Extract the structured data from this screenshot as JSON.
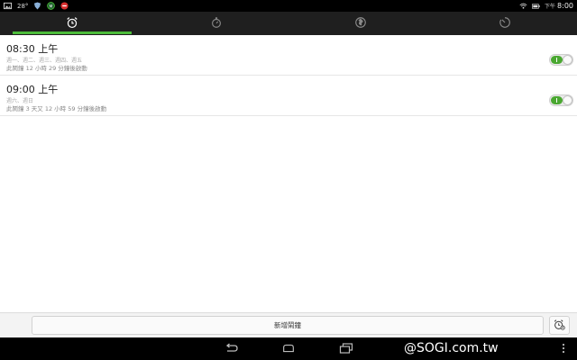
{
  "status_bar": {
    "temperature": "28°",
    "left_icons": [
      "image-icon",
      "shield-icon",
      "badge-icon",
      "app-icon"
    ],
    "right_icons": [
      "wifi-icon",
      "battery-icon"
    ],
    "ampm": "下午",
    "time": "8:00"
  },
  "tabs": [
    {
      "icon": "alarm-clock-icon",
      "active": true
    },
    {
      "icon": "stopwatch-icon",
      "active": false
    },
    {
      "icon": "world-clock-icon",
      "active": false
    },
    {
      "icon": "timer-icon",
      "active": false
    }
  ],
  "alarms": [
    {
      "time": "08:30 上午",
      "days": "週一、週二、週三、週四、週五",
      "remaining": "此鬧鐘 12 小時 29 分鐘後啟動",
      "enabled": true
    },
    {
      "time": "09:00 上午",
      "days": "週六、週日",
      "remaining": "此鬧鐘 3 天又 12 小時 59 分鐘後啟動",
      "enabled": true
    }
  ],
  "action_bar": {
    "add_alarm_label": "新增鬧鐘",
    "settings_icon": "alarm-settings-icon"
  },
  "nav_bar": {
    "icons": [
      "back-icon",
      "home-icon",
      "recent-apps-icon",
      "menu-icon"
    ],
    "watermark": "@SOGI.com.tw"
  },
  "colors": {
    "accent": "#4cbb3a",
    "toggle_on": "#4aa831",
    "tab_bar_bg": "#1f1f1f"
  }
}
